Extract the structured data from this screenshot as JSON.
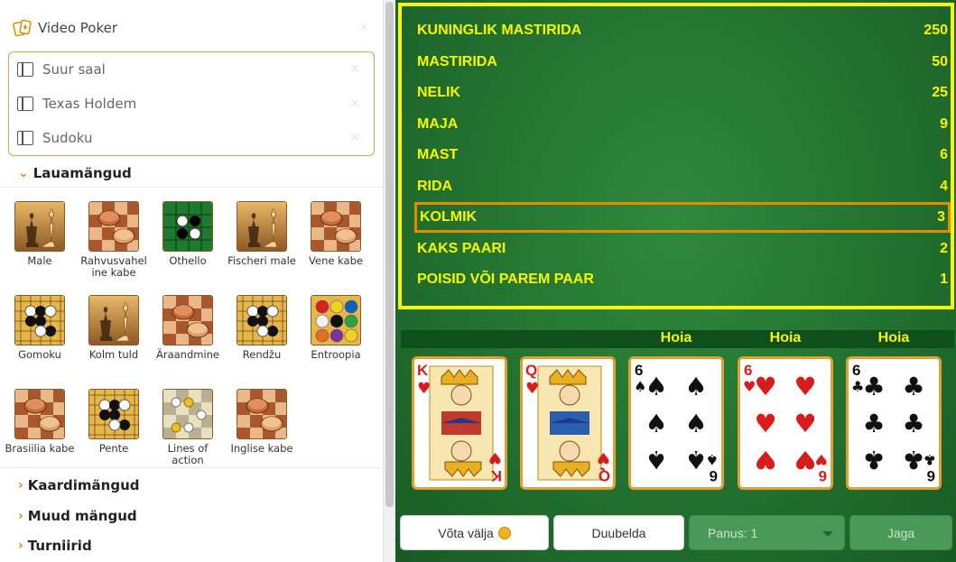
{
  "sidebar": {
    "video_poker": "Video Poker",
    "pinned": [
      {
        "label": "Suur saal"
      },
      {
        "label": "Texas Holdem"
      },
      {
        "label": "Sudoku"
      }
    ],
    "board_games_header": "Lauamängud",
    "board_games": [
      {
        "label": "Male",
        "icon": "chess"
      },
      {
        "label": "Rahvusvahel ine kabe",
        "icon": "checkers"
      },
      {
        "label": "Othello",
        "icon": "othello"
      },
      {
        "label": "Fischeri male",
        "icon": "chess"
      },
      {
        "label": "Vene kabe",
        "icon": "checkers"
      },
      {
        "label": "Gomoku",
        "icon": "go"
      },
      {
        "label": "Kolm tuld",
        "icon": "chess"
      },
      {
        "label": "Äraandmine",
        "icon": "checkers"
      },
      {
        "label": "Rendžu",
        "icon": "go"
      },
      {
        "label": "Entroopia",
        "icon": "entropy"
      },
      {
        "label": "Brasiilia kabe",
        "icon": "checkers"
      },
      {
        "label": "Pente",
        "icon": "go"
      },
      {
        "label": "Lines of action",
        "icon": "lines"
      },
      {
        "label": "Inglise kabe",
        "icon": "checkers"
      }
    ],
    "card_games_header": "Kaardimängud",
    "other_games_header": "Muud mängud",
    "tournaments_header": "Turniirid"
  },
  "paytable": [
    {
      "hand": "KUNINGLIK MASTIRIDA",
      "pay": "250"
    },
    {
      "hand": "MASTIRIDA",
      "pay": "50"
    },
    {
      "hand": "NELIK",
      "pay": "25"
    },
    {
      "hand": "MAJA",
      "pay": "9"
    },
    {
      "hand": "MAST",
      "pay": "6"
    },
    {
      "hand": "RIDA",
      "pay": "4"
    },
    {
      "hand": "KOLMIK",
      "pay": "3"
    },
    {
      "hand": "KAKS PAARI",
      "pay": "2"
    },
    {
      "hand": "POISID VÕI PAREM PAAR",
      "pay": "1"
    }
  ],
  "highlighted_hand": "KOLMIK",
  "hand": [
    {
      "rank": "K",
      "suit": "hearts",
      "held": false,
      "hold_label": ""
    },
    {
      "rank": "Q",
      "suit": "hearts",
      "held": false,
      "hold_label": ""
    },
    {
      "rank": "6",
      "suit": "spades",
      "held": true,
      "hold_label": "Hoia"
    },
    {
      "rank": "6",
      "suit": "hearts",
      "held": true,
      "hold_label": "Hoia"
    },
    {
      "rank": "6",
      "suit": "clubs",
      "held": true,
      "hold_label": "Hoia"
    }
  ],
  "controls": {
    "collect": "Võta välja",
    "double": "Duubelda",
    "bet": "Panus: 1",
    "deal": "Jaga"
  },
  "colors": {
    "felt": "#1f6a2c",
    "paytable_text": "#f7f700",
    "highlight": "#e68a00",
    "accent": "#e68a00"
  }
}
